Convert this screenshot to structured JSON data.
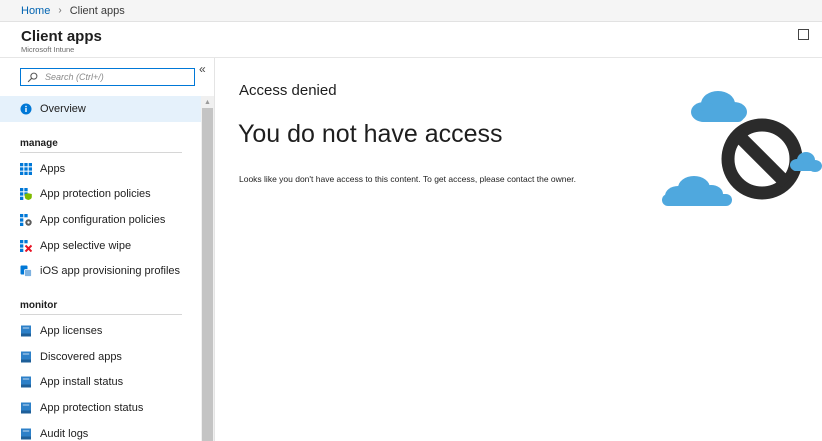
{
  "breadcrumb": {
    "home": "Home",
    "separator": "›",
    "current": "Client apps"
  },
  "blade": {
    "title": "Client apps",
    "subtitle": "Microsoft Intune"
  },
  "search": {
    "placeholder": "Search (Ctrl+/)"
  },
  "collapse_glyph": "«",
  "nav": {
    "overview": {
      "label": "Overview",
      "icon": "info-icon",
      "selected": true
    },
    "manage": {
      "header": "manage",
      "items": [
        {
          "label": "Apps",
          "icon": "apps-grid-icon"
        },
        {
          "label": "App protection policies",
          "icon": "app-protection-icon"
        },
        {
          "label": "App configuration policies",
          "icon": "app-config-icon"
        },
        {
          "label": "App selective wipe",
          "icon": "selective-wipe-icon"
        },
        {
          "label": "iOS app provisioning profiles",
          "icon": "provisioning-icon"
        }
      ]
    },
    "monitor": {
      "header": "monitor",
      "items": [
        {
          "label": "App licenses",
          "icon": "report-icon"
        },
        {
          "label": "Discovered apps",
          "icon": "report-icon"
        },
        {
          "label": "App install status",
          "icon": "report-icon"
        },
        {
          "label": "App protection status",
          "icon": "report-icon"
        },
        {
          "label": "Audit logs",
          "icon": "report-icon"
        }
      ]
    }
  },
  "content": {
    "heading": "Access denied",
    "title": "You do not have access",
    "message": "Looks like you don't have access to this content. To get access, please contact the owner."
  },
  "colors": {
    "accent": "#0078d7",
    "link": "#0063b1",
    "selected_bg": "#e5f1fb",
    "cloud": "#4fa8de",
    "deny_symbol": "#2b2b2b"
  }
}
